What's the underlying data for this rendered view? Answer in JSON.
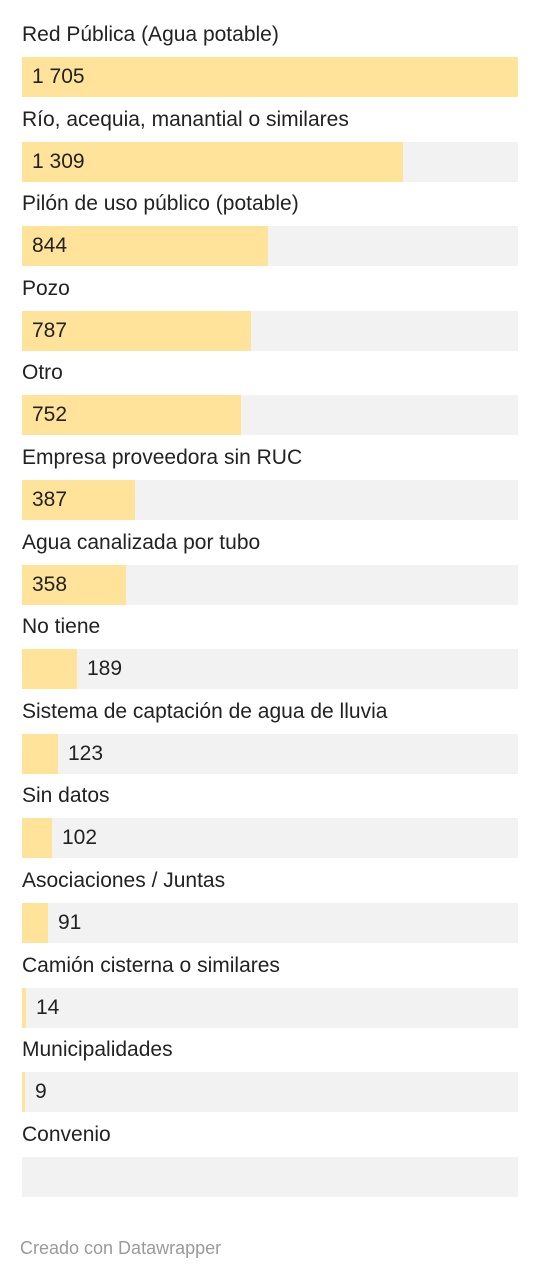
{
  "chart_data": {
    "type": "bar",
    "orientation": "horizontal",
    "categories": [
      "Red Pública (Agua potable)",
      "Río, acequia, manantial o similares",
      "Pilón de uso público (potable)",
      "Pozo",
      "Otro",
      "Empresa proveedora sin RUC",
      "Agua canalizada por tubo",
      "No tiene",
      "Sistema de captación de agua de lluvia",
      "Sin datos",
      "Asociaciones / Juntas",
      "Camión cisterna o similares",
      "Municipalidades",
      "Convenio"
    ],
    "values": [
      1705,
      1309,
      844,
      787,
      752,
      387,
      358,
      189,
      123,
      102,
      91,
      14,
      9,
      0
    ],
    "value_labels": [
      "1 705",
      "1 309",
      "844",
      "787",
      "752",
      "387",
      "358",
      "189",
      "123",
      "102",
      "91",
      "14",
      "9",
      ""
    ],
    "xlim": [
      0,
      1705
    ],
    "grid": false,
    "colors": {
      "bar": "#ffe39a",
      "track": "#f2f2f2",
      "text": "#222222"
    }
  },
  "footer": {
    "credit": "Creado con Datawrapper",
    "color": "#9a9a9a"
  }
}
